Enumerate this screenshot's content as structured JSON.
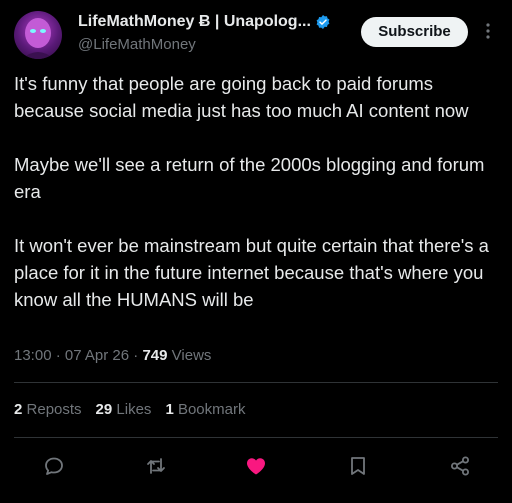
{
  "author": {
    "display_name": "LifeMathMoney Ƀ | Unapolog...",
    "handle": "@LifeMathMoney",
    "verified_icon": "verified-badge-icon",
    "accent_color": "#1d9bf0"
  },
  "header": {
    "subscribe_label": "Subscribe",
    "more_icon": "more-vertical-icon"
  },
  "tweet": {
    "paragraphs": [
      "It's funny that people are going back to paid forums because social media just has too much AI content now",
      "Maybe we'll see a return of the 2000s blogging and forum era",
      "It won't ever be mainstream but quite certain that there's a place for it in the future internet because that's where you know all the HUMANS will be"
    ],
    "time": "13:00",
    "date": "07 Apr 26",
    "views_count": "749",
    "views_label": "Views"
  },
  "stats": {
    "reposts_count": "2",
    "reposts_label": "Reposts",
    "likes_count": "29",
    "likes_label": "Likes",
    "bookmarks_count": "1",
    "bookmarks_label": "Bookmark"
  },
  "actions": {
    "reply_icon": "reply-icon",
    "repost_icon": "repost-icon",
    "like_icon": "heart-filled-icon",
    "like_color": "#f91880",
    "bookmark_icon": "bookmark-icon",
    "share_icon": "share-icon"
  }
}
